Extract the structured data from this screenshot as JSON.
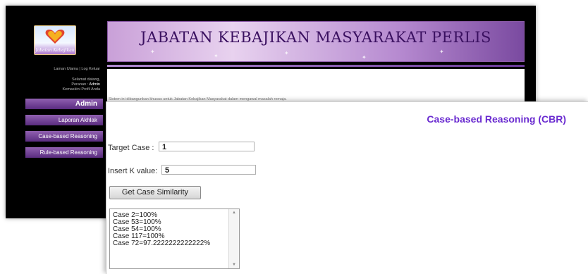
{
  "back_window": {
    "banner_title": "JABATAN KEBAJIKAN MASYARAKAT PERLIS",
    "logo_text": "Jabatan Kebajikan",
    "nav_links": "Laman Utama | Log Keluar",
    "user_info": {
      "line1": "Selamat datang,",
      "line2_prefix": "Peranan : ",
      "role": "Admin",
      "line3": "Kemaskini Profil Anda"
    },
    "sidebar_buttons": [
      "Admin",
      "Laporan Akhlak",
      "Case-based Reasoning",
      "Rule-based Reasoning"
    ],
    "welcome_text": "Sistem ini dibangunkan khusus untuk Jabatan Kebajikan Masyarakat dalam mengawal masalah remaja."
  },
  "front_window": {
    "title": "Case-based Reasoning (CBR)",
    "target_case_label": "Target Case :",
    "target_case_value": "1",
    "k_label": "Insert K value:",
    "k_value": "5",
    "button_label": "Get Case Similarity",
    "results": [
      "Case 2=100%",
      "Case 53=100%",
      "Case 54=100%",
      "Case 117=100%",
      "Case 72=97.2222222222222%"
    ]
  },
  "colors": {
    "title_purple": "#6a2bd0",
    "sidebar_button": "#7a46a0",
    "banner_text": "#3a1060"
  }
}
